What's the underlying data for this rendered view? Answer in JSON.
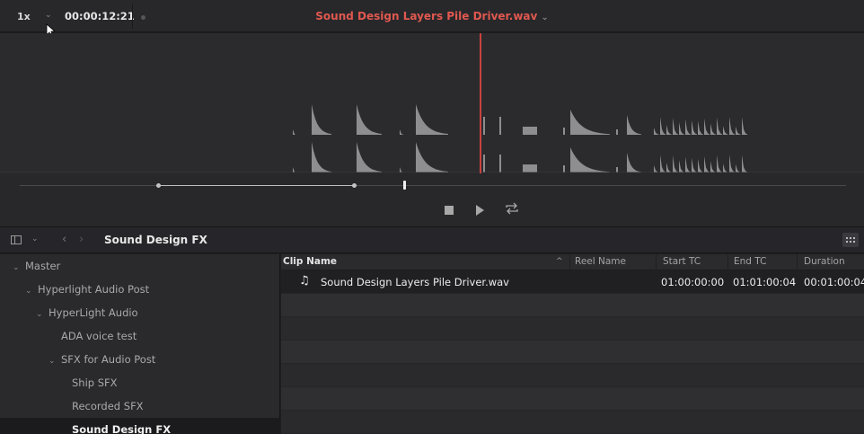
{
  "viewer": {
    "zoom": "1x",
    "timecode": "00:00:12:21",
    "clip_title": "Sound Design Layers Pile Driver.wav",
    "playhead_fraction": 0.556,
    "scrub_in_fraction": 0.18,
    "scrub_out_fraction": 0.41,
    "scrub_position_fraction": 0.468
  },
  "pool": {
    "title": "Sound Design FX"
  },
  "tree": [
    {
      "label": "Master",
      "arrow": "⌄",
      "level": 0
    },
    {
      "label": "Hyperlight Audio Post",
      "arrow": "⌄",
      "level": 1
    },
    {
      "label": "HyperLight Audio",
      "arrow": "⌄",
      "level": 2
    },
    {
      "label": "ADA voice test",
      "arrow": "",
      "level": 3
    },
    {
      "label": "SFX for Audio Post",
      "arrow": "⌄",
      "level": 3
    },
    {
      "label": "Ship SFX",
      "arrow": "",
      "level": 4
    },
    {
      "label": "Recorded SFX",
      "arrow": "",
      "level": 4
    },
    {
      "label": "Sound Design FX",
      "arrow": "",
      "level": 4,
      "selected": true
    }
  ],
  "columns": {
    "clip_name": "Clip Name",
    "reel_name": "Reel Name",
    "start_tc": "Start TC",
    "end_tc": "End TC",
    "duration": "Duration"
  },
  "clips": [
    {
      "name": "Sound Design Layers Pile Driver.wav",
      "reel_name": "",
      "start_tc": "01:00:00:00",
      "end_tc": "01:01:00:04",
      "duration": "00:01:00:04",
      "icon": "music-note-icon"
    }
  ],
  "colors": {
    "accent_title": "#e0584f",
    "playhead": "#c8433d",
    "waveform": "#8e8e90"
  }
}
